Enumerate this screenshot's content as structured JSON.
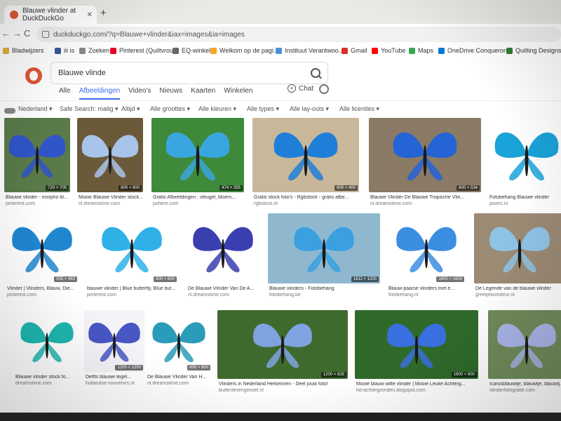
{
  "browser": {
    "tab_title": "Blauwe vlinder at DuckDuckGo",
    "tab_close": "✕",
    "new_tab": "+",
    "back": "←",
    "forward": "→",
    "reload": "C",
    "home": "⌂",
    "url": "duckduckgo.com/?q=Blauwe+vlinder&iax=images&ia=images"
  },
  "bookmarks": [
    {
      "label": "Bladwijzers",
      "color": "#e0b03a"
    },
    {
      "label": "iii is",
      "color": "#3b5998"
    },
    {
      "label": "Zoeken",
      "color": "#888888"
    },
    {
      "label": "Pinterest (Quiltvrou...",
      "color": "#e60023"
    },
    {
      "label": "EQ-winkel",
      "color": "#666666"
    },
    {
      "label": "Welkom op de pagi...",
      "color": "#f5a623"
    },
    {
      "label": "Instituut Verantwoo...",
      "color": "#4a90d9"
    },
    {
      "label": "Gmail",
      "color": "#d93025"
    },
    {
      "label": "YouTube",
      "color": "#ff0000"
    },
    {
      "label": "Maps",
      "color": "#34a853"
    },
    {
      "label": "OneDrive Conquerors",
      "color": "#0078d4"
    },
    {
      "label": "Quilting Designs, E...",
      "color": "#2e7d32"
    }
  ],
  "search": {
    "query": "Blauwe vlinde"
  },
  "vertical_tabs": [
    {
      "label": "Alle",
      "active": false
    },
    {
      "label": "Afbeeldingen",
      "active": true
    },
    {
      "label": "Video's",
      "active": false
    },
    {
      "label": "Nieuws",
      "active": false
    },
    {
      "label": "Kaarten",
      "active": false
    },
    {
      "label": "Winkelen",
      "active": false
    }
  ],
  "chat_label": "Chat",
  "filters": [
    "Nederland ▾",
    "Safe Search: matig ▾",
    "Altijd ▾",
    "Alle groottes ▾",
    "Alle kleuren ▾",
    "Alle types ▾",
    "Alle lay-outs ▾",
    "Alle licenties ▾"
  ],
  "results": [
    {
      "title": "Blauwe vlinder - morpho bl...",
      "source": "pinterest.com",
      "size": "720 × 705",
      "bg": "#5a7a4a",
      "wing": "#2f55c8"
    },
    {
      "title": "Mooie Blauwe Vlinder stock...",
      "source": "nl.dreamstime.com",
      "size": "800 × 800",
      "bg": "#6b5a3a",
      "wing": "#a9c4ea"
    },
    {
      "title": "Gratis Afbeeldingen : vleugel, bloem,...",
      "source": "pxhere.com",
      "size": "474 × 355",
      "bg": "#3f8a3a",
      "wing": "#39a6e0"
    },
    {
      "title": "Gratis stock foto's - Rgbstock - gratis afbe...",
      "source": "rgbstock.nl",
      "size": "600 × 400",
      "bg": "#c9b79a",
      "wing": "#1f7fd8"
    },
    {
      "title": "Blauwe Vlinder De Blauwe Tropische Vlin...",
      "source": "nl.dreamstime.com",
      "size": "800 × 534",
      "bg": "#8a7a66",
      "wing": "#2464d6"
    },
    {
      "title": "Fotobehang Blauwe vlinder",
      "source": "pixers.nl",
      "size": "",
      "bg": "#ffffff",
      "wing": "#1aa3d8"
    },
    {
      "title": "Vlinder | Vlinders, Blauw, Die...",
      "source": "pinterest.com",
      "size": "505 × 463",
      "bg": "#ffffff",
      "wing": "#1f86d0"
    },
    {
      "title": "blauwe vlinder | Blue butterfly, Blue but...",
      "source": "pinterest.com",
      "size": "800 × 800",
      "bg": "#ffffff",
      "wing": "#2fb1e8"
    },
    {
      "title": "De Blauwe Vlinder Van De A...",
      "source": "nl.dreamstime.com",
      "size": "",
      "bg": "#ffffff",
      "wing": "#3a3fb0"
    },
    {
      "title": "Blauwe vlinders - Fotobehang",
      "source": "fotobehang.be",
      "size": "1811 × 1200",
      "bg": "#8fb8cf",
      "wing": "#3aa0e0"
    },
    {
      "title": "Blauw-paarse vlinders met e...",
      "source": "fotobehang.nl",
      "size": "1600 × 1600",
      "bg": "#ffffff",
      "wing": "#3b8ee0"
    },
    {
      "title": "De Legende van de blauwe vlinder",
      "source": "greetjekomdeur.nl",
      "size": "",
      "bg": "#9b8a74",
      "wing": "#8fc3e6"
    },
    {
      "title": "Blauwe vlinder stock fo...",
      "source": "dreamstime.com",
      "size": "",
      "bg": "#ffffff",
      "wing": "#1fb6b0"
    },
    {
      "title": "Delfts blauwe tegel...",
      "source": "hollandse-souvenirs.nl",
      "size": "1200 × 1200",
      "bg": "#f4f4f8",
      "wing": "#4856c4"
    },
    {
      "title": "De Blauwe Vlinder Van H...",
      "source": "nl.dreamstime.com",
      "size": "800 × 800",
      "bg": "#ffffff",
      "wing": "#2a9bb8"
    },
    {
      "title": "Vlinders in Nederland Herkennen - Deel jouw foto!",
      "source": "buitenlevengevoel.nl",
      "size": "1200 × 628",
      "bg": "#3f6a2e",
      "wing": "#7fa3e0"
    },
    {
      "title": "Mooie blauw witte vlinder | Mooie Leuke Achterg...",
      "source": "hd-achtergronden.blogspot.com",
      "size": "1600 × 900",
      "bg": "#2f6a2a",
      "wing": "#3a6fe0"
    },
    {
      "title": "Icarusblauwtje, blauwtje, blauwtj...",
      "source": "vlinderfotografie.com",
      "size": "",
      "bg": "#6f8a5a",
      "wing": "#a8b4e8"
    }
  ]
}
